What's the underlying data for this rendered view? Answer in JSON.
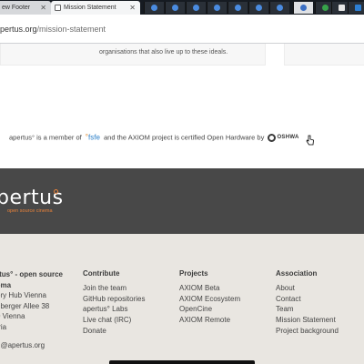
{
  "browser": {
    "tabs": [
      {
        "label": "ew Footer",
        "active": false
      },
      {
        "label": "Mission Statement",
        "active": true
      }
    ],
    "pinned_tab_count": 11,
    "url_host": "pertus.org",
    "url_path": "/mission-statement"
  },
  "content": {
    "card_text": "organisations that also live up to these ideals.",
    "membership": {
      "prefix": "apertus° is a member of",
      "fsfe_logo": "fsfe",
      "middle": "and the AXIOM project is certified Open Hardware by",
      "oshwa_logo": "OSHWA"
    }
  },
  "footer": {
    "logo": {
      "word": "pertus",
      "tagline": "open source cinema"
    },
    "colors": {
      "band": "#484848",
      "footer_bg": "#e9e6e1",
      "accent": "#e8823a"
    },
    "address": {
      "title_line1": "rtus° - open source",
      "title_line2": "ema",
      "lines": [
        "ory Hub Vienna",
        "riberger Allee 38",
        "0 Vienna",
        "tria"
      ],
      "email": "n@apertus.org"
    },
    "contribute": {
      "heading": "Contribute",
      "links": [
        "Join the team",
        "GitHub repositories",
        "apertus° Labs",
        "Live chat (IRC)",
        "Donate"
      ]
    },
    "projects": {
      "heading": "Projects",
      "links": [
        "AXIOM Beta",
        "AXIOM Ecosystem",
        "OpenCine",
        "AXIOM Remote"
      ]
    },
    "association": {
      "heading": "Association",
      "links": [
        "About",
        "Contact",
        "Team",
        "Mission Statement",
        "Project background"
      ]
    }
  }
}
